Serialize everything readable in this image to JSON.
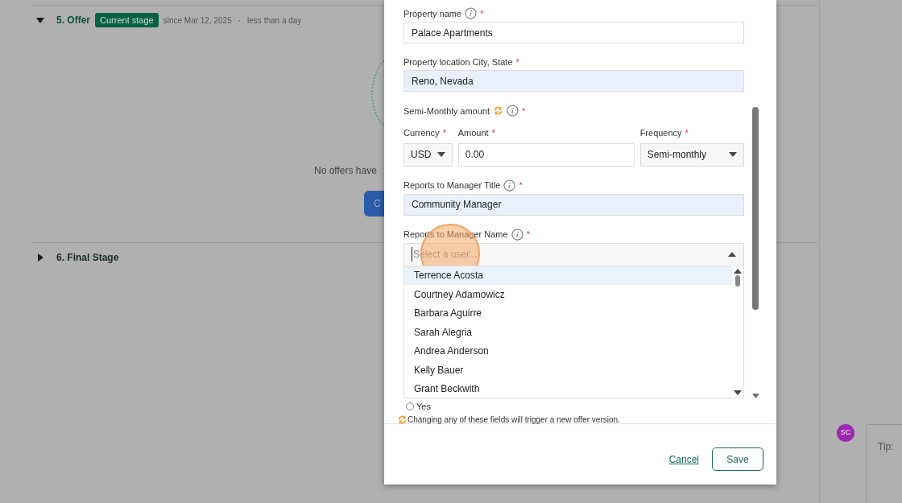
{
  "stages": [
    {
      "title": "5. Offer",
      "expanded": true,
      "badge": "Current stage",
      "since": "since Mar 12, 2025",
      "separator": "·",
      "duration": "less than a day",
      "empty_text": "No offers have",
      "button": "C"
    },
    {
      "title": "6. Final Stage",
      "expanded": false
    }
  ],
  "comment": {
    "avatar": "SC",
    "tip": "Tip:"
  },
  "form": {
    "fields": [
      {
        "kind": "text",
        "label": "Property name",
        "info": true,
        "required": true,
        "value": "Palace Apartments",
        "autofilled": false
      },
      {
        "kind": "text",
        "label": "Property location City, State",
        "info": false,
        "required": true,
        "value": "Reno, Nevada",
        "autofilled": true
      },
      {
        "kind": "amount",
        "label": "Semi-Monthly amount",
        "info": true,
        "required": true,
        "versioned": true,
        "currency_label": "Currency",
        "currency": "USD",
        "amount_label": "Amount",
        "amount": "0.00",
        "frequency_label": "Frequency",
        "frequency": "Semi-monthly"
      },
      {
        "kind": "text",
        "label": "Reports to Manager Title",
        "info": true,
        "required": true,
        "value": "Community Manager",
        "autofilled": true
      },
      {
        "kind": "combo",
        "label": "Reports to Manager Name",
        "info": true,
        "required": true,
        "placeholder": "Select a user...",
        "expanded": true,
        "options": [
          {
            "label": "Terrence Acosta",
            "selected": true
          },
          {
            "label": "Courtney Adamowicz",
            "selected": false
          },
          {
            "label": "Barbara Aguirre",
            "selected": false
          },
          {
            "label": "Sarah Alegria",
            "selected": false
          },
          {
            "label": "Andrea Anderson",
            "selected": false
          },
          {
            "label": "Kelly Bauer",
            "selected": false
          },
          {
            "label": "Grant Beckwith",
            "selected": false
          }
        ]
      }
    ],
    "radio": {
      "label": "Yes",
      "selected": false
    },
    "required_mark": "*",
    "note": "Changing any of these fields will trigger a new offer version.",
    "cancel": "Cancel",
    "save": "Save"
  }
}
